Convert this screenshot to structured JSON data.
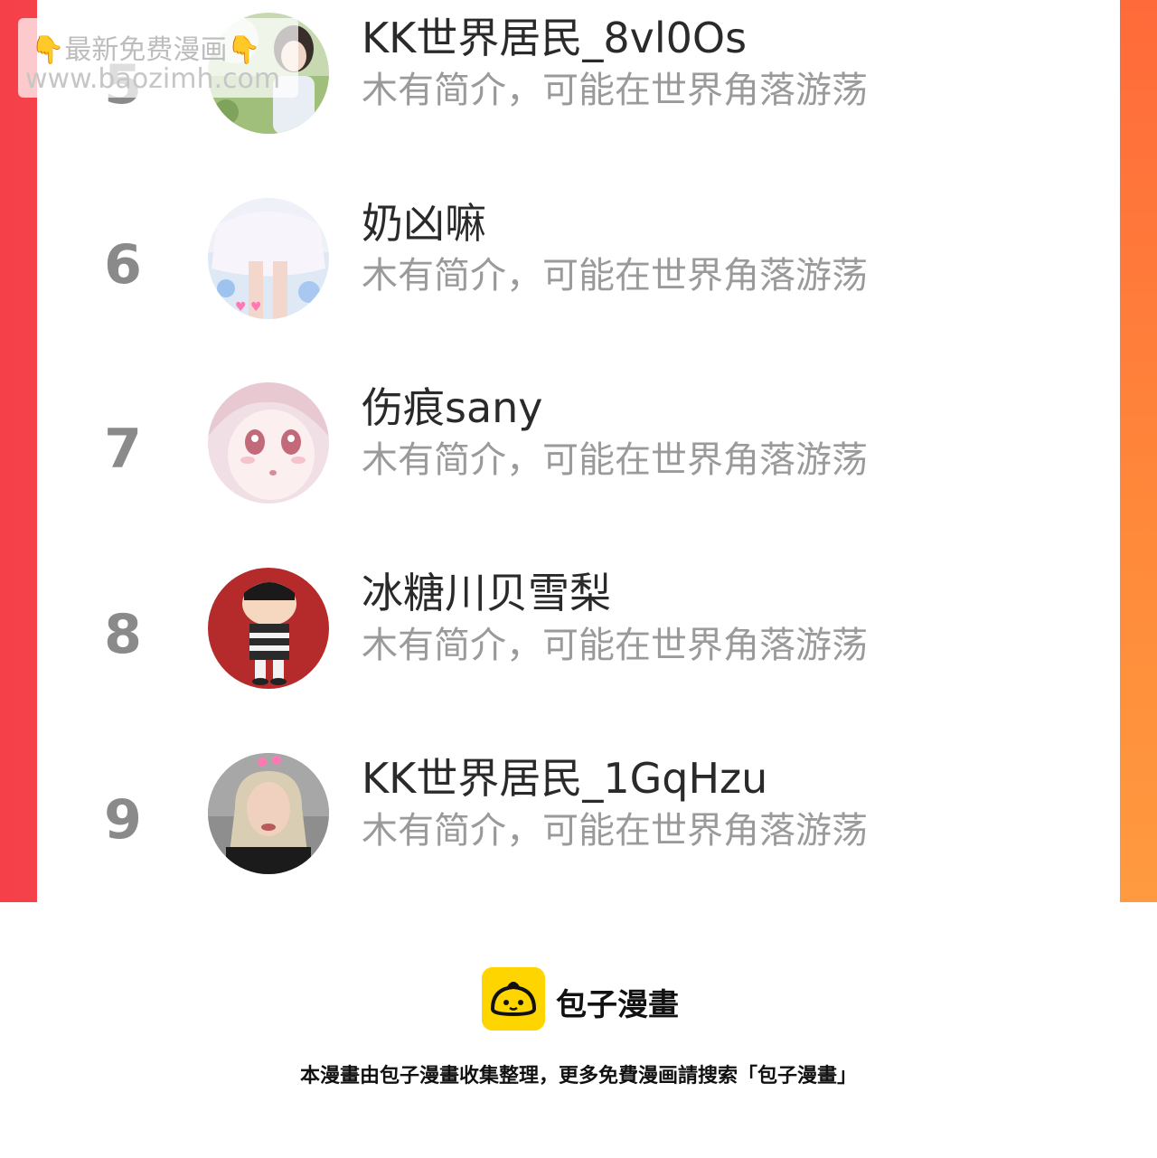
{
  "watermark": {
    "line1": "最新免费漫画",
    "line2": "www.baozimh.com",
    "finger_glyph": "👇"
  },
  "ranking": {
    "items": [
      {
        "rank": "5",
        "name": "KK世界居民_8vl0Os",
        "bio": "木有简介，可能在世界角落游荡",
        "avatar": "photo-girl-outdoors"
      },
      {
        "rank": "6",
        "name": "奶凶嘛",
        "bio": "木有简介，可能在世界角落游荡",
        "avatar": "photo-skirt-pastel"
      },
      {
        "rank": "7",
        "name": "伤痕sany",
        "bio": "木有简介，可能在世界角落游荡",
        "avatar": "anime-girl"
      },
      {
        "rank": "8",
        "name": "冰糖川贝雪梨",
        "bio": "木有简介，可能在世界角落游荡",
        "avatar": "cartoon-boy-red"
      },
      {
        "rank": "9",
        "name": "KK世界居民_1GqHzu",
        "bio": "木有简介，可能在世界角落游荡",
        "avatar": "photo-blonde-woman"
      }
    ]
  },
  "brand": {
    "logo_icon": "bun-logo-icon",
    "name": "包子漫畫",
    "accent": "#ffd500"
  },
  "footer": {
    "note": "本漫畫由包子漫畫收集整理，更多免費漫画請搜索「包子漫畫」"
  },
  "colors": {
    "frame_left": "#f5404a",
    "frame_right": "#ff7a3c",
    "rank": "#8a8a8a",
    "name": "#2a2a2a",
    "bio": "#9a9a9a"
  }
}
